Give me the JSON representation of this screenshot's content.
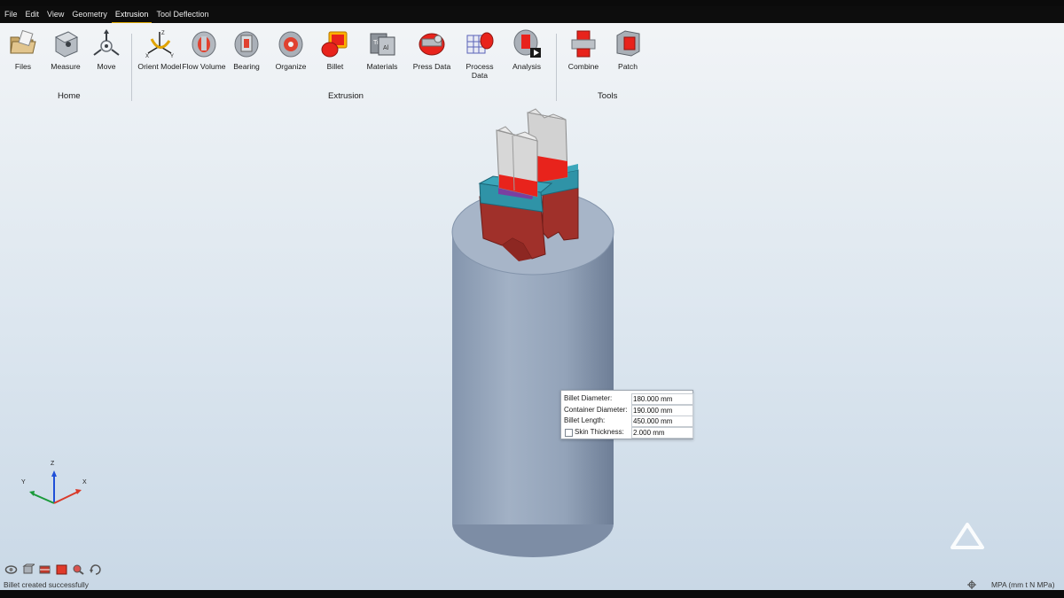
{
  "menu": {
    "items": [
      "File",
      "Edit",
      "View",
      "Geometry",
      "Extrusion",
      "Tool Deflection"
    ],
    "active": "Extrusion"
  },
  "ribbon": {
    "groups": {
      "home": "Home",
      "extrusion": "Extrusion",
      "tools": "Tools"
    },
    "tools": {
      "files": "Files",
      "measure": "Measure",
      "move": "Move",
      "orient_model": "Orient Model",
      "flow_volume": "Flow Volume",
      "bearing": "Bearing",
      "organize": "Organize",
      "billet": "Billet",
      "materials": "Materials",
      "press_data": "Press Data",
      "process_data": "Process\nData",
      "analysis": "Analysis",
      "combine": "Combine",
      "patch": "Patch"
    }
  },
  "billet_params": {
    "billet_diameter_label": "Billet Diameter:",
    "billet_diameter_value": "180.000 mm",
    "container_diameter_label": "Container Diameter:",
    "container_diameter_value": "190.000 mm",
    "billet_length_label": "Billet Length:",
    "billet_length_value": "450.000 mm",
    "skin_thickness_label": "Skin Thickness:",
    "skin_thickness_value": "2.000 mm",
    "skin_thickness_checked": false
  },
  "axes": {
    "z": "Z",
    "y": "Y",
    "x": "X"
  },
  "status": {
    "message": "Billet created successfully",
    "units": "MPA (mm t N MPa)"
  },
  "colors": {
    "billet_body": "#99a9bf",
    "die_red": "#e8231c",
    "die_teal": "#2f93a7",
    "die_dark_red": "#a0302a",
    "profile_gray": "#d2d2d2",
    "menu_active_underline": "#d8a300"
  }
}
